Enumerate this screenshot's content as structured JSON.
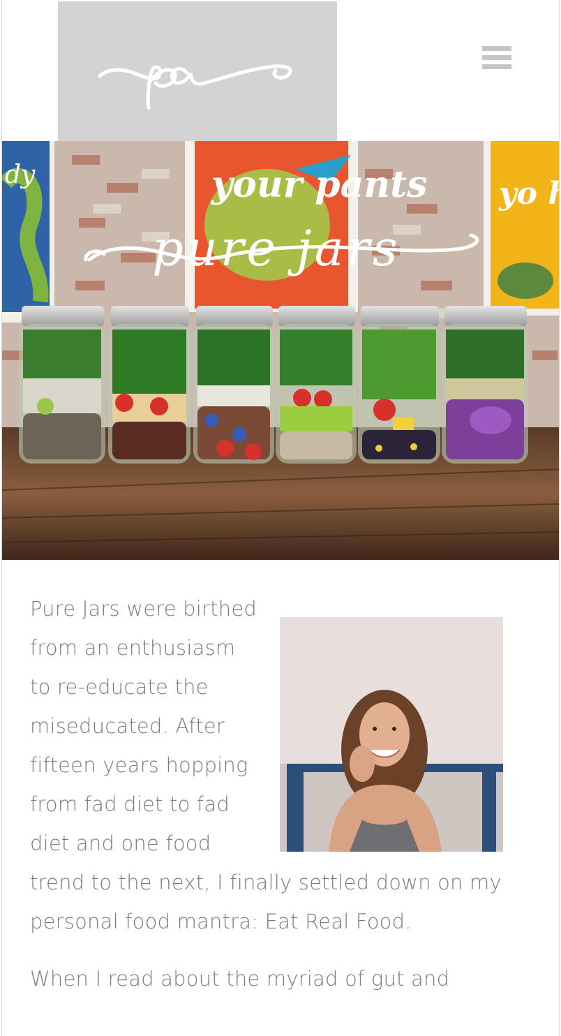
{
  "header": {
    "logo_text": "pa",
    "menu_icon": "hamburger-icon"
  },
  "hero": {
    "title": "pure jars",
    "poster_center": "your pants",
    "poster_left": "dy",
    "poster_right": "yo ho"
  },
  "article": {
    "paragraph_1": "Pure Jars were birthed from an enthusiasm to re-educate the miseducated. After fifteen years hopping from fad diet to fad diet and one food trend to the next, I finally settled down on my personal food mantra: Eat Real Food.",
    "paragraph_2": "When I read about the myriad of gut and"
  },
  "colors": {
    "logo_bg": "#d3d3d3",
    "menu_icon": "#c6c6c6",
    "body_text": "#7b7b7b"
  }
}
